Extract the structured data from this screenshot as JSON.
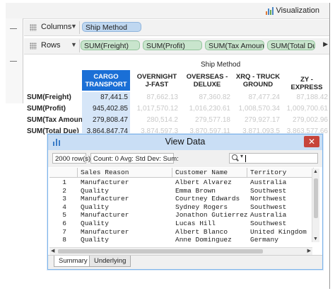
{
  "toolbar": {
    "visualization_label": "Visualization"
  },
  "shelves": {
    "columns": {
      "label": "Columns",
      "pills": [
        "Ship Method"
      ]
    },
    "rows": {
      "label": "Rows",
      "pills": [
        "SUM(Freight)",
        "SUM(Profit)",
        "SUM(Tax Amount)",
        "SUM(Total Due)"
      ]
    }
  },
  "crosstab": {
    "header_title": "Ship Method",
    "columns": [
      {
        "line1": "CARGO",
        "line2": "TRANSPORT"
      },
      {
        "line1": "OVERNIGHT",
        "line2": "J-FAST"
      },
      {
        "line1": "OVERSEAS -",
        "line2": "DELUXE"
      },
      {
        "line1": "XRQ - TRUCK",
        "line2": "GROUND"
      },
      {
        "line1": "ZY - EXPRESS",
        "line2": ""
      }
    ],
    "rows": [
      {
        "label": "SUM(Freight)",
        "values": [
          "87,441.5",
          "87,662.13",
          "87,360.82",
          "87,477.24",
          "87,188.42"
        ]
      },
      {
        "label": "SUM(Profit)",
        "values": [
          "945,402.85",
          "1,017,570.12",
          "1,016,230.61",
          "1,008,570.34",
          "1,009,700.61"
        ]
      },
      {
        "label": "SUM(Tax Amount)",
        "values": [
          "279,808.47",
          "280,514.2",
          "279,577.18",
          "279,927.17",
          "279,002.96"
        ]
      },
      {
        "label": "SUM(Total Due)",
        "values": [
          "3,864,847.74",
          "3,874,597.3",
          "3,870,597.11",
          "3,871,093.5",
          "3,863,577.66"
        ]
      }
    ]
  },
  "dialog": {
    "title": "View Data",
    "row_count": "2000 row(s)",
    "stats_label": "Count: 0  Avg:  Std Dev:  Sum:",
    "table": {
      "columns": [
        "Sales Reason",
        "Customer Name",
        "Territory"
      ],
      "rows": [
        {
          "n": "1",
          "reason": "Manufacturer",
          "customer": "Albert Alvarez",
          "territory": "Australia"
        },
        {
          "n": "2",
          "reason": "Quality",
          "customer": "Emma Brown",
          "territory": "Southwest"
        },
        {
          "n": "3",
          "reason": "Manufacturer",
          "customer": "Courtney Edwards",
          "territory": "Northwest"
        },
        {
          "n": "4",
          "reason": "Quality",
          "customer": "Sydney Rogers",
          "territory": "Southwest"
        },
        {
          "n": "5",
          "reason": "Manufacturer",
          "customer": "Jonathon Gutierrez",
          "territory": "Australia"
        },
        {
          "n": "6",
          "reason": "Quality",
          "customer": "Lucas Hill",
          "territory": "Southwest"
        },
        {
          "n": "7",
          "reason": "Manufacturer",
          "customer": "Albert Blanco",
          "territory": "United Kingdom"
        },
        {
          "n": "8",
          "reason": "Quality",
          "customer": "Anne Dominguez",
          "territory": "Germany"
        }
      ]
    },
    "tabs": [
      "Summary",
      "Underlying"
    ]
  }
}
